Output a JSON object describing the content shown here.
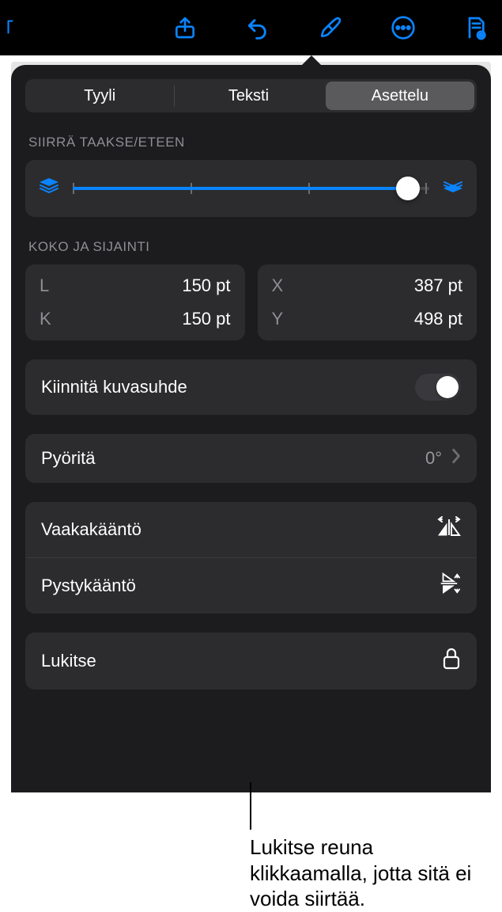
{
  "tabs": {
    "style": "Tyyli",
    "text": "Teksti",
    "layout": "Asettelu"
  },
  "sections": {
    "zorder": "SIIRRÄ TAAKSE/ETEEN",
    "sizepos": "KOKO JA SIJAINTI"
  },
  "dims": {
    "w_label": "L",
    "w_val": "150 pt",
    "h_label": "K",
    "h_val": "150 pt",
    "x_label": "X",
    "x_val": "387 pt",
    "y_label": "Y",
    "y_val": "498 pt"
  },
  "rows": {
    "aspect": "Kiinnitä kuvasuhde",
    "rotate": "Pyöritä",
    "rotate_val": "0°",
    "fliph": "Vaakakääntö",
    "flipv": "Pystykääntö",
    "lock": "Lukitse"
  },
  "callout": "Lukitse reuna klikkaamalla, jotta sitä ei voida siirtää."
}
